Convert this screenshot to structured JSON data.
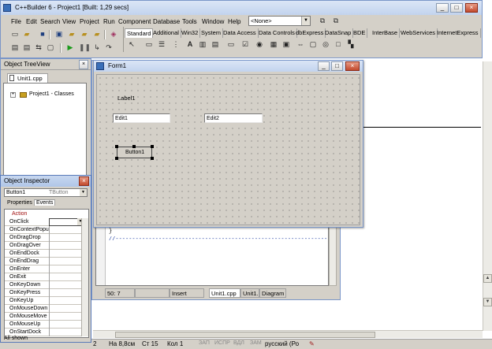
{
  "app": {
    "title": "C++Builder 6 - Project1 [Built: 1,29 secs]",
    "window_controls": {
      "minimize": "_",
      "maximize": "□",
      "close": "×"
    }
  },
  "menu": [
    "File",
    "Edit",
    "Search",
    "View",
    "Project",
    "Run",
    "Component",
    "Database",
    "Tools",
    "Window",
    "Help"
  ],
  "toolbar": {
    "config_dropdown": "<None>",
    "icons": [
      "new-icon",
      "open-icon",
      "save-icon",
      "save-all-icon",
      "open-project-icon",
      "add-file-icon",
      "remove-file-icon",
      "help-icon",
      "run-icon",
      "pause-icon",
      "trace-icon",
      "step-over-icon"
    ]
  },
  "palette": {
    "tabs": [
      "Standard",
      "Additional",
      "Win32",
      "System",
      "Data Access",
      "Data Controls",
      "dbExpress",
      "DataSnap",
      "BDE",
      "InterBase",
      "WebServices",
      "InternetExpress"
    ],
    "active_tab": "Standard",
    "components": [
      "pointer-icon",
      "frame-icon",
      "mainmenu-icon",
      "popupmenu-icon",
      "label-icon",
      "edit-icon",
      "memo-icon",
      "button-icon",
      "checkbox-icon",
      "radiobutton-icon",
      "listbox-icon",
      "combobox-icon",
      "scrollbar-icon",
      "groupbox-icon",
      "radiogroup-icon",
      "panel-icon",
      "actionlist-icon"
    ]
  },
  "tree_view": {
    "title": "Object TreeView",
    "tab": "Unit1.cpp",
    "item": "Project1 - Classes"
  },
  "form": {
    "title": "Form1",
    "label": "Label1",
    "edit1": "Edit1",
    "edit2": "Edit2",
    "button": "Button1"
  },
  "code_editor": {
    "line1": "}",
    "line2": "//-----------------------------------------------------------------",
    "status": {
      "position": "50:  7",
      "mode": "Insert"
    },
    "tabs": [
      "Unit1.cpp",
      "Unit1.h",
      "Diagram"
    ]
  },
  "inspector": {
    "title": "Object Inspector",
    "object_name": "Button1",
    "object_type": "TButton",
    "tabs": [
      "Properties",
      "Events"
    ],
    "active_tab": "Events",
    "header": "Action",
    "events": [
      "OnClick",
      "OnContextPopu",
      "OnDragDrop",
      "OnDragOver",
      "OnEndDock",
      "OnEndDrag",
      "OnEnter",
      "OnExit",
      "OnKeyDown",
      "OnKeyPress",
      "OnKeyUp",
      "OnMouseDown",
      "OnMouseMove",
      "OnMouseUp",
      "OnStartDock"
    ],
    "footer": "All shown"
  },
  "word_status": {
    "page": "2",
    "position": "На 8,8см",
    "line": "Ст 15",
    "column": "Кол 1",
    "modes": [
      "ЗАП",
      "ИСПР",
      "ВДЛ",
      "ЗАМ"
    ],
    "language": "русский (Ро"
  }
}
